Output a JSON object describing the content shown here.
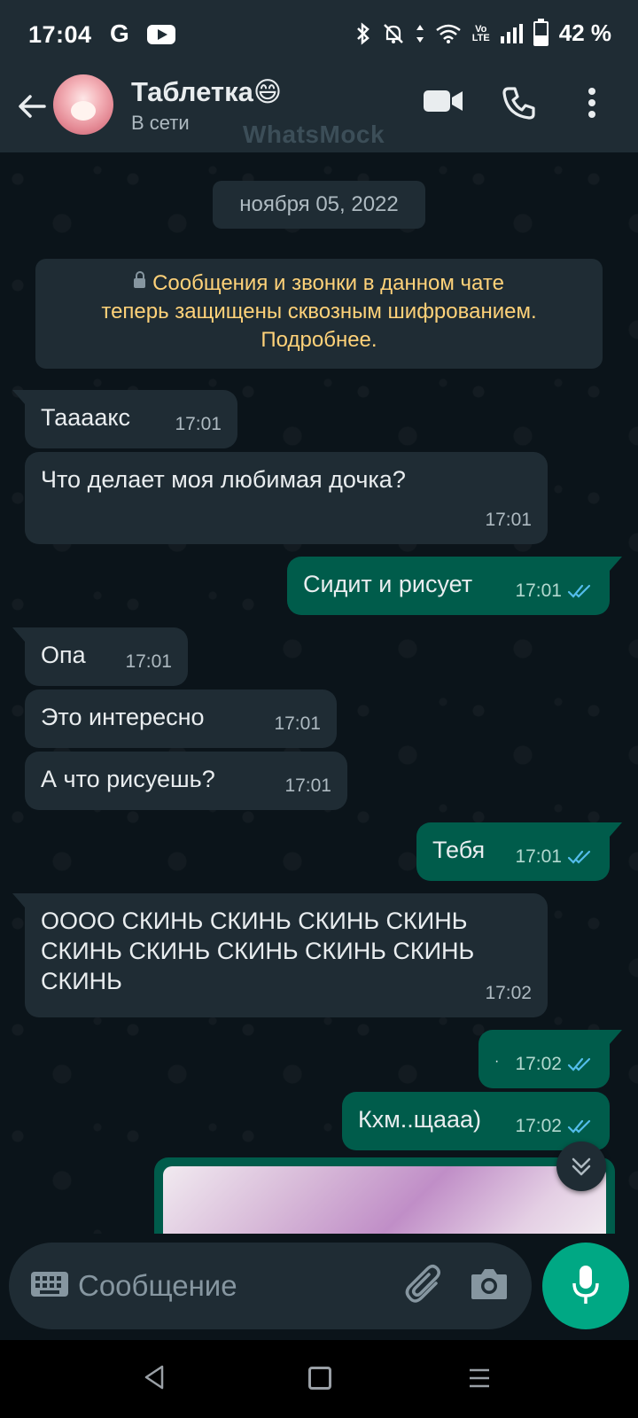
{
  "status_bar": {
    "time": "17:04",
    "battery_text": "42 %",
    "lte_label": "Vo\nLTE"
  },
  "header": {
    "contact_name": "Таблетка😄",
    "contact_status": "В сети",
    "watermark": "WhatsMock"
  },
  "chat": {
    "date_chip": "ноября 05, 2022",
    "encryption_notice": [
      "Сообщения и звонки в данном чате",
      "теперь защищены сквозным шифрованием.",
      "Подробнее."
    ],
    "messages": [
      {
        "dir": "in",
        "text": "Таааакс",
        "time": "17:01"
      },
      {
        "dir": "in",
        "text": "Что делает моя любимая дочка?",
        "time": "17:01"
      },
      {
        "dir": "out",
        "text": "Сидит и рисует",
        "time": "17:01"
      },
      {
        "dir": "in",
        "text": "Опа",
        "time": "17:01"
      },
      {
        "dir": "in",
        "text": "Это интересно",
        "time": "17:01"
      },
      {
        "dir": "in",
        "text": "А что рисуешь?",
        "time": "17:01"
      },
      {
        "dir": "out",
        "text": "Тебя",
        "time": "17:01"
      },
      {
        "dir": "in",
        "text": "ОООО СКИНЬ СКИНЬ СКИНЬ СКИНЬ СКИНЬ СКИНЬ СКИНЬ СКИНЬ СКИНЬ СКИНЬ",
        "time": "17:02"
      },
      {
        "dir": "out",
        "text": "·",
        "time": "17:02"
      },
      {
        "dir": "out",
        "text": "Кхм..щааа)",
        "time": "17:02"
      }
    ]
  },
  "composer": {
    "placeholder": "Сообщение"
  },
  "colors": {
    "incoming_bubble": "#1f2c34",
    "outgoing_bubble": "#005c4b",
    "accent": "#00a884",
    "read_ticks": "#53bdeb",
    "notice_text": "#ffd279"
  },
  "icons": [
    "back-arrow-icon",
    "video-call-icon",
    "phone-icon",
    "more-vert-icon",
    "lock-icon",
    "double-check-icon",
    "chevron-down-icon",
    "keyboard-icon",
    "paperclip-icon",
    "camera-icon",
    "mic-icon"
  ]
}
